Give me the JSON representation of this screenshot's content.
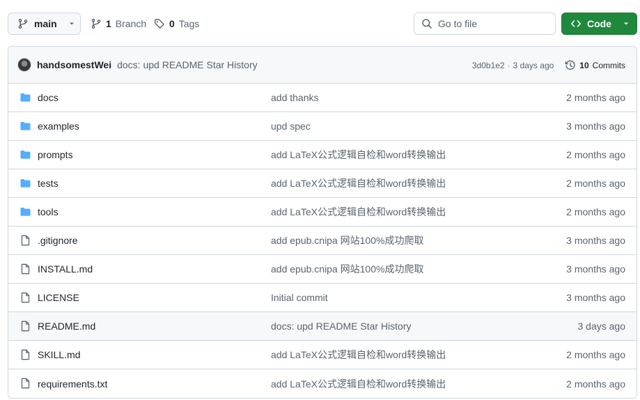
{
  "toolbar": {
    "branch_label": "main",
    "branches_count": "1",
    "branches_label": "Branch",
    "tags_count": "0",
    "tags_label": "Tags",
    "search_placeholder": "Go to file",
    "code_label": "Code"
  },
  "latest_commit": {
    "author": "handsomestWei",
    "message": "docs: upd README Star History",
    "sha": "3d0b1e2",
    "separator": "·",
    "age": "3 days ago",
    "commits_count": "10",
    "commits_label": "Commits"
  },
  "files": [
    {
      "type": "folder",
      "name": "docs",
      "message": "add thanks",
      "age": "2 months ago"
    },
    {
      "type": "folder",
      "name": "examples",
      "message": "upd spec",
      "age": "3 months ago"
    },
    {
      "type": "folder",
      "name": "prompts",
      "message": "add LaTeX公式逻辑自检和word转换输出",
      "age": "2 months ago"
    },
    {
      "type": "folder",
      "name": "tests",
      "message": "add LaTeX公式逻辑自检和word转换输出",
      "age": "2 months ago"
    },
    {
      "type": "folder",
      "name": "tools",
      "message": "add LaTeX公式逻辑自检和word转换输出",
      "age": "2 months ago"
    },
    {
      "type": "file",
      "name": ".gitignore",
      "message": "add epub.cnipa 网站100%成功爬取",
      "age": "3 months ago"
    },
    {
      "type": "file",
      "name": "INSTALL.md",
      "message": "add epub.cnipa 网站100%成功爬取",
      "age": "3 months ago"
    },
    {
      "type": "file",
      "name": "LICENSE",
      "message": "Initial commit",
      "age": "3 months ago"
    },
    {
      "type": "file",
      "name": "README.md",
      "message": "docs: upd README Star History",
      "age": "3 days ago",
      "highlighted": true
    },
    {
      "type": "file",
      "name": "SKILL.md",
      "message": "add LaTeX公式逻辑自检和word转换输出",
      "age": "2 months ago"
    },
    {
      "type": "file",
      "name": "requirements.txt",
      "message": "add LaTeX公式逻辑自检和word转换输出",
      "age": "2 months ago"
    }
  ],
  "colors": {
    "folder_icon": "#54aeff",
    "file_icon": "#59636e",
    "primary_button": "#1f883d"
  },
  "icons": {
    "branch": "git-branch-icon",
    "tag": "tag-icon",
    "search": "search-icon",
    "code": "code-icon",
    "history": "history-icon",
    "folder": "folder-icon",
    "file": "file-icon"
  }
}
